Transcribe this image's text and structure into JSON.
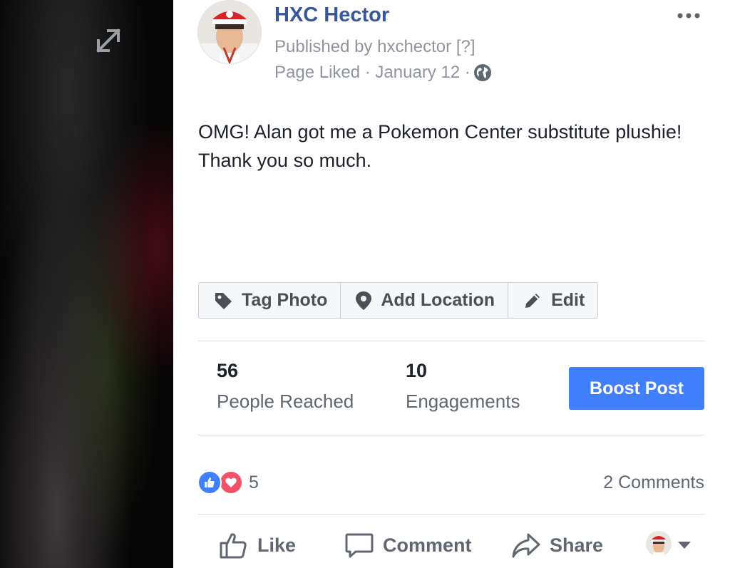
{
  "post": {
    "page_name": "HXC Hector",
    "published_by": "Published by hxchector [?]",
    "meta_prefix": "Page Liked · January 12 ·",
    "text": "OMG! Alan got me a Pokemon Center substitute plushie! Thank you so much."
  },
  "photo_actions": {
    "tag_photo": "Tag Photo",
    "add_location": "Add Location",
    "edit": "Edit"
  },
  "stats": {
    "reached_value": "56",
    "reached_label": "People Reached",
    "engagements_value": "10",
    "engagements_label": "Engagements",
    "boost_label": "Boost Post"
  },
  "reactions": {
    "count": "5",
    "comments": "2 Comments"
  },
  "footer": {
    "like": "Like",
    "comment": "Comment",
    "share": "Share"
  },
  "colors": {
    "brand_link": "#365899",
    "boost_blue": "#4080ff",
    "like_blue": "#4080ff",
    "love_red": "#f25268"
  },
  "icons": [
    "expand-icon",
    "more-options-icon",
    "globe-icon",
    "tag-icon",
    "location-pin-icon",
    "pencil-icon",
    "like-reaction-icon",
    "love-reaction-icon",
    "thumbs-up-icon",
    "comment-bubble-icon",
    "share-arrow-icon",
    "caret-down-icon"
  ]
}
